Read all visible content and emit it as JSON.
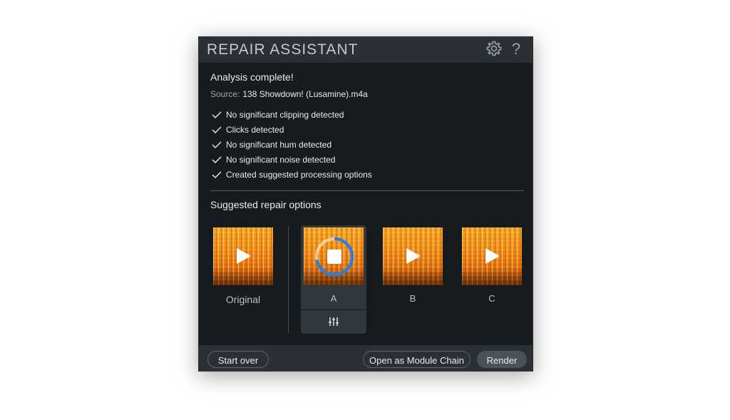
{
  "window": {
    "title": "REPAIR ASSISTANT",
    "settings_icon": "gear-icon",
    "help_label": "?"
  },
  "analysis": {
    "title": "Analysis complete!",
    "source_label": "Source:",
    "source_file": "138 Showdown! (Lusamine).m4a",
    "checks": [
      "No significant clipping detected",
      "Clicks detected",
      "No significant hum detected",
      "No significant noise detected",
      "Created suggested processing options"
    ]
  },
  "suggestions": {
    "title": "Suggested repair options",
    "original_label": "Original",
    "options": [
      {
        "label": "A",
        "state": "playing"
      },
      {
        "label": "B",
        "state": "stopped"
      },
      {
        "label": "C",
        "state": "stopped"
      }
    ],
    "playback_progress": 0.72
  },
  "footer": {
    "start_over": "Start over",
    "open_module_chain": "Open as Module Chain",
    "render": "Render"
  },
  "colors": {
    "accent": "#2f7fd6",
    "background": "#161b1f",
    "titlebar": "#2a3036"
  }
}
